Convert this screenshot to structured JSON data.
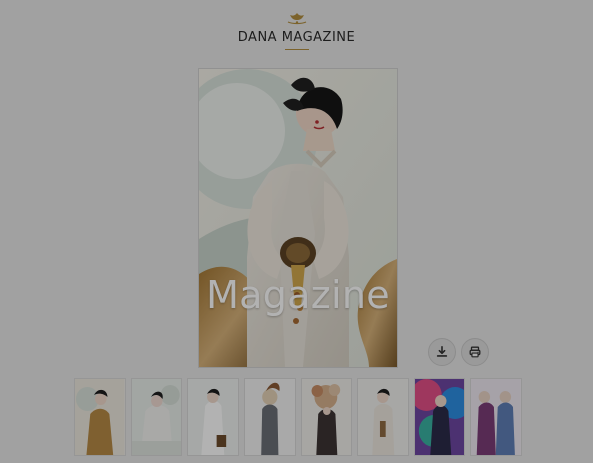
{
  "site": {
    "logo_text": "DANA MAGAZINE",
    "accent_color": "#b28f3f"
  },
  "cover": {
    "label": "Magazine",
    "image_alt": "Magazine cover photo"
  },
  "actions": {
    "download_icon": "download-icon",
    "print_icon": "print-icon"
  },
  "thumbnails": [
    {
      "image": "thumbnail-1"
    },
    {
      "image": "thumbnail-2"
    },
    {
      "image": "thumbnail-3"
    },
    {
      "image": "thumbnail-4"
    },
    {
      "image": "thumbnail-5"
    },
    {
      "image": "thumbnail-6"
    },
    {
      "image": "thumbnail-7"
    },
    {
      "image": "thumbnail-8"
    }
  ]
}
